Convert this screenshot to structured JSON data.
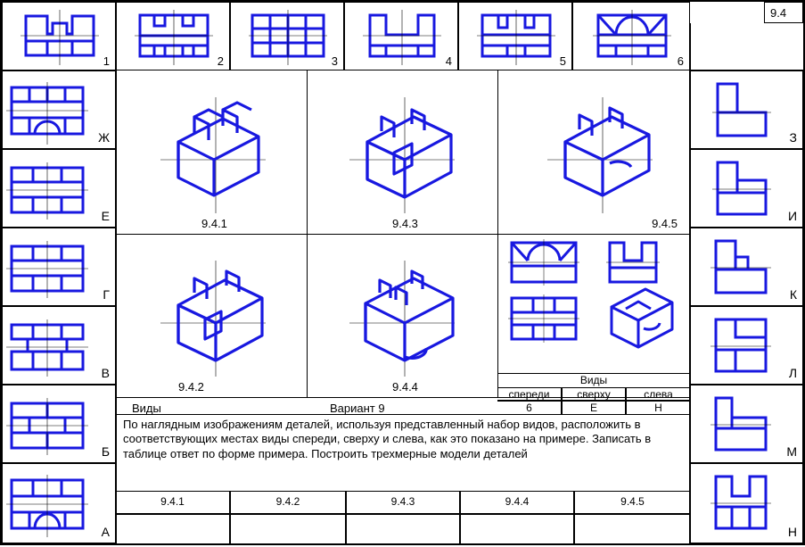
{
  "page_number": "9.4",
  "top_views": [
    {
      "n": "1"
    },
    {
      "n": "2"
    },
    {
      "n": "3"
    },
    {
      "n": "4"
    },
    {
      "n": "5"
    },
    {
      "n": "6"
    }
  ],
  "left_views": [
    {
      "l": "Ж"
    },
    {
      "l": "Е"
    },
    {
      "l": "Г"
    },
    {
      "l": "В"
    },
    {
      "l": "Б"
    },
    {
      "l": "А"
    }
  ],
  "right_views": [
    {
      "l": "З"
    },
    {
      "l": "И"
    },
    {
      "l": "К"
    },
    {
      "l": "Л"
    },
    {
      "l": "М"
    },
    {
      "l": "Н"
    }
  ],
  "iso": {
    "a": "9.4.1",
    "b": "9.4.2",
    "c": "9.4.3",
    "d": "9.4.4",
    "e": "9.4.5"
  },
  "views_label": "Виды",
  "view_headers": {
    "front": "спереди",
    "top": "сверху",
    "left": "слева"
  },
  "example_row": {
    "front": "6",
    "top": "Е",
    "left": "Н"
  },
  "variant_label": "Вариант 9",
  "task_title": "Виды",
  "task_body": "По наглядным изображениям деталей, используя представленный набор видов, расположить в соответствующих местах виды спереди, сверху и слева, как это показано на примере. Записать в таблице ответ по форме  примера. Построить трехмерные модели деталей",
  "answer_cols": [
    "9.4.1",
    "9.4.2",
    "9.4.3",
    "9.4.4",
    "9.4.5"
  ]
}
